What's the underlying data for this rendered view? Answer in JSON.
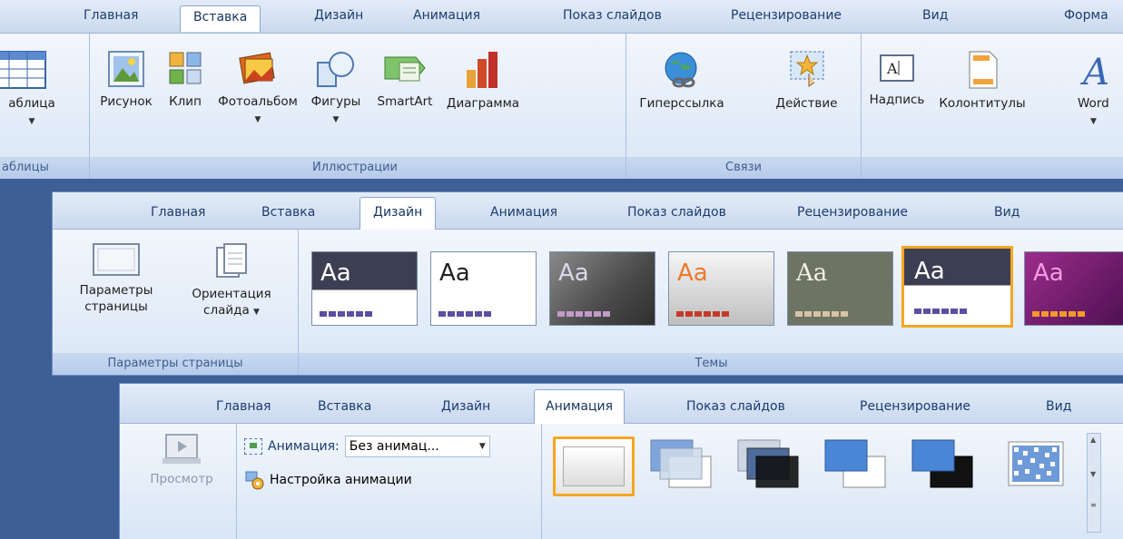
{
  "ribbon1": {
    "tabs": [
      "Главная",
      "Вставка",
      "Дизайн",
      "Анимация",
      "Показ слайдов",
      "Рецензирование",
      "Вид",
      "Форма"
    ],
    "active_tab": "Вставка",
    "groups": [
      {
        "label": "аблицы",
        "buttons": [
          "аблица"
        ]
      },
      {
        "label": "Иллюстрации",
        "buttons": [
          "Рисунок",
          "Клип",
          "Фотоальбом",
          "Фигуры",
          "SmartArt",
          "Диаграмма"
        ]
      },
      {
        "label": "Связи",
        "buttons": [
          "Гиперссылка",
          "Действие"
        ]
      },
      {
        "label": "",
        "buttons": [
          "Надпись",
          "Колонтитулы",
          "Word"
        ]
      }
    ]
  },
  "ribbon2": {
    "tabs": [
      "Главная",
      "Вставка",
      "Дизайн",
      "Анимация",
      "Показ слайдов",
      "Рецензирование",
      "Вид"
    ],
    "active_tab": "Дизайн",
    "page_setup": {
      "label": "Параметры страницы",
      "btn1": "Параметры страницы",
      "btn2": "Ориентация слайда"
    },
    "themes_label": "Темы",
    "theme_text": "Aa"
  },
  "ribbon3": {
    "tabs": [
      "Главная",
      "Вставка",
      "Дизайн",
      "Анимация",
      "Показ слайдов",
      "Рецензирование",
      "Вид"
    ],
    "active_tab": "Анимация",
    "preview": "Просмотр",
    "animation_label": "Анимация:",
    "animation_value": "Без анимац...",
    "custom_animation": "Настройка анимации"
  },
  "colors": {
    "accent": "#f5a623"
  }
}
